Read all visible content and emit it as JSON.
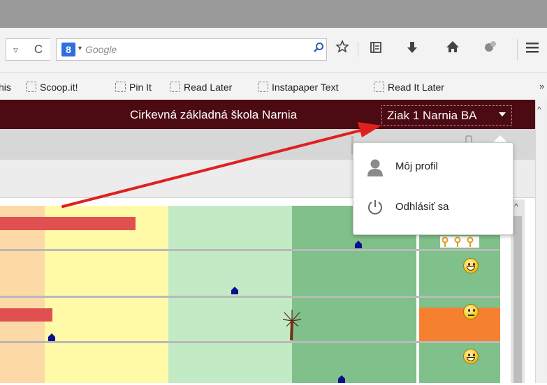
{
  "browser": {
    "search": {
      "engine_badge": "8",
      "placeholder": "Google"
    },
    "bookmarks": {
      "items": [
        {
          "label": "his"
        },
        {
          "label": "Scoop.it!"
        },
        {
          "label": "Pin It"
        },
        {
          "label": "Read Later"
        },
        {
          "label": "Instapaper Text"
        },
        {
          "label": "Read It Later"
        }
      ],
      "overflow": "»"
    }
  },
  "page": {
    "school_name": "Cirkevná základná škola Narnia",
    "user_menu_label": "Ziak 1 Narnia BA",
    "user_dropdown": {
      "items": [
        {
          "label": "Môj profil",
          "icon": "user-icon"
        },
        {
          "label": "Odhlásiť sa",
          "icon": "power-icon"
        }
      ]
    },
    "colors": {
      "header": "#4c0a12",
      "band_orange": "#fcd9a6",
      "band_yellow": "#fffaa8",
      "band_light_green": "#c2ebc5",
      "band_green": "#80c08a",
      "status_orange": "#f58030",
      "annotation_arrow": "#e02020"
    }
  }
}
